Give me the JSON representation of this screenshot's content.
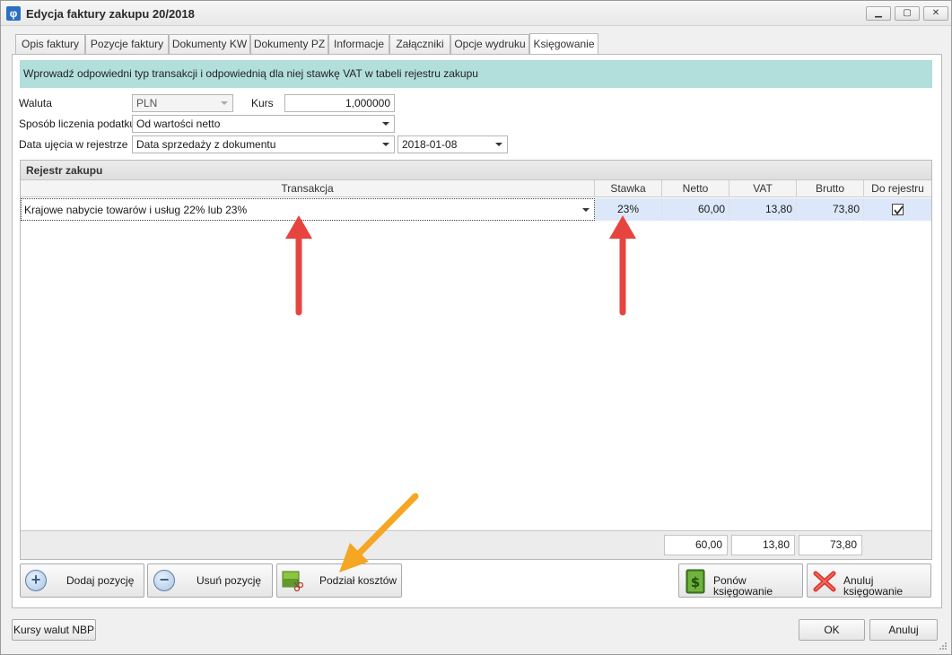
{
  "window": {
    "title": "Edycja faktury zakupu 20/2018",
    "app_icon_glyph": "φ",
    "minimize": "▁",
    "maximize": "▢",
    "close": "✕"
  },
  "tabs": [
    {
      "label": "Opis faktury",
      "active": false
    },
    {
      "label": "Pozycje faktury",
      "active": false
    },
    {
      "label": "Dokumenty KW",
      "active": false
    },
    {
      "label": "Dokumenty PZ",
      "active": false
    },
    {
      "label": "Informacje",
      "active": false
    },
    {
      "label": "Załączniki",
      "active": false
    },
    {
      "label": "Opcje wydruku",
      "active": false
    },
    {
      "label": "Księgowanie",
      "active": true
    }
  ],
  "info_text": "Wprowadź odpowiedni typ transakcji i odpowiednią dla niej stawkę VAT w tabeli rejestru zakupu",
  "form": {
    "currency_label": "Waluta",
    "currency_value": "PLN",
    "rate_label": "Kurs",
    "rate_value": "1,000000",
    "tax_method_label": "Sposób liczenia podatku",
    "tax_method_value": "Od wartości netto",
    "register_date_label": "Data ujęcia w rejestrze",
    "register_date_source": "Data sprzedaży z dokumentu",
    "register_date_value": "2018-01-08"
  },
  "register": {
    "title": "Rejestr zakupu",
    "columns": [
      "Transakcja",
      "Stawka",
      "Netto",
      "VAT",
      "Brutto",
      "Do rejestru"
    ],
    "rows": [
      {
        "transakcja": "Krajowe nabycie towarów i usług 22% lub 23%",
        "stawka": "23%",
        "netto": "60,00",
        "vat": "13,80",
        "brutto": "73,80",
        "do_rejestru": true
      }
    ],
    "totals": {
      "netto": "60,00",
      "vat": "13,80",
      "brutto": "73,80"
    }
  },
  "buttons": {
    "add_position": "Dodaj pozycję",
    "remove_position": "Usuń pozycję",
    "cost_split": "Podział kosztów",
    "repost": "Ponów księgowanie",
    "cancel_posting": "Anuluj księgowanie",
    "nbp_rates": "Kursy walut NBP",
    "ok": "OK",
    "cancel": "Anuluj"
  },
  "colors": {
    "info_bar": "#b2dfdc",
    "selected_row": "#dce8fa",
    "annotation_red": "#e8443f",
    "annotation_orange": "#f5a623"
  }
}
